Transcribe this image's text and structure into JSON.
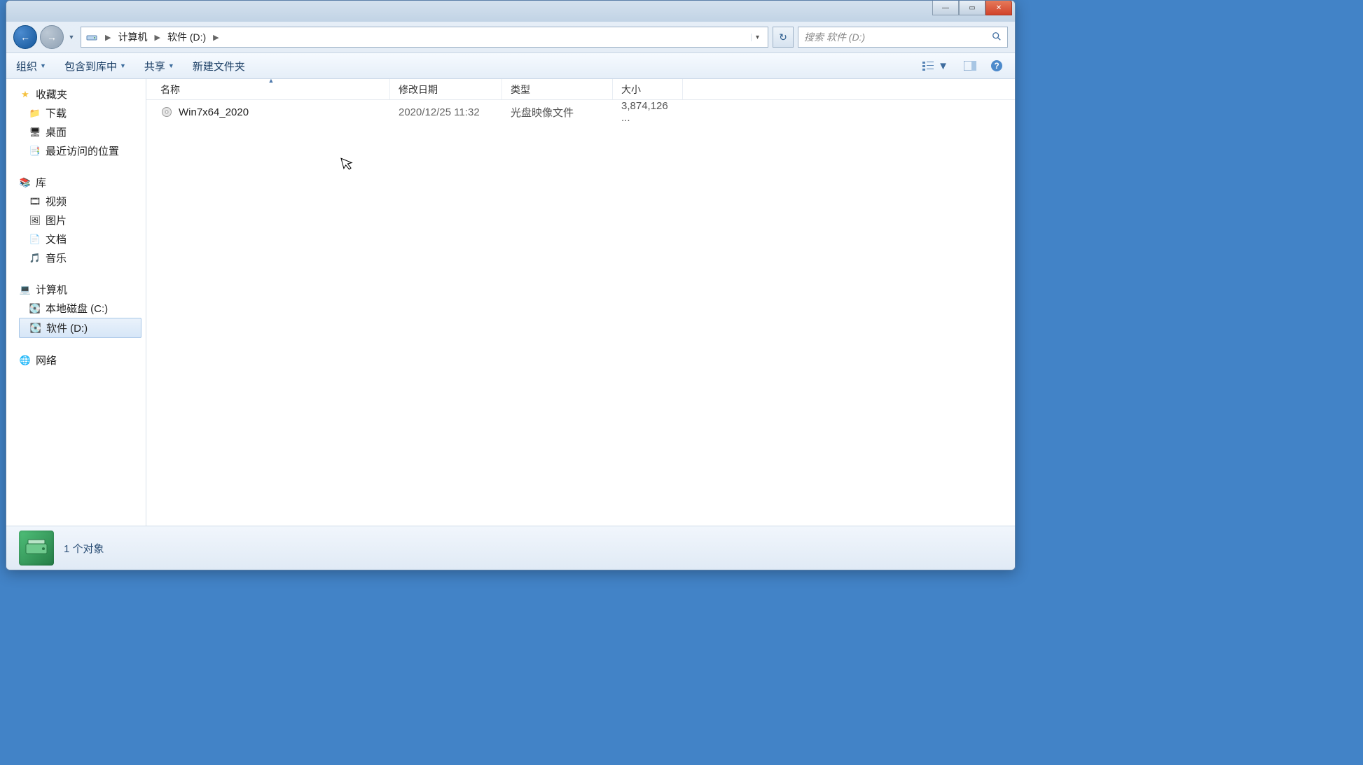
{
  "breadcrumb": {
    "root": "计算机",
    "current": "软件 (D:)"
  },
  "search": {
    "placeholder": "搜索 软件 (D:)"
  },
  "toolbar": {
    "organize": "组织",
    "include": "包含到库中",
    "share": "共享",
    "new_folder": "新建文件夹"
  },
  "columns": {
    "name": "名称",
    "date": "修改日期",
    "type": "类型",
    "size": "大小"
  },
  "files": [
    {
      "name": "Win7x64_2020",
      "date": "2020/12/25 11:32",
      "type": "光盘映像文件",
      "size": "3,874,126 ..."
    }
  ],
  "sidebar": {
    "favorites": {
      "label": "收藏夹",
      "items": [
        "下载",
        "桌面",
        "最近访问的位置"
      ]
    },
    "libraries": {
      "label": "库",
      "items": [
        "视频",
        "图片",
        "文档",
        "音乐"
      ]
    },
    "computer": {
      "label": "计算机",
      "items": [
        "本地磁盘 (C:)",
        "软件 (D:)"
      ]
    },
    "network": {
      "label": "网络"
    }
  },
  "status": {
    "count": "1 个对象"
  }
}
